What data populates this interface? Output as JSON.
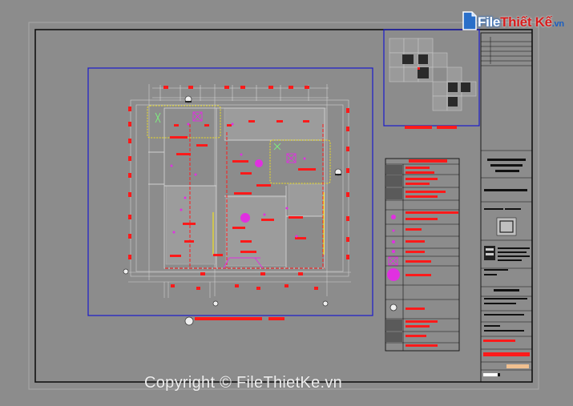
{
  "logo": {
    "brand_white": "File",
    "brand_red": "Thiết Kế",
    "domain": ".vn"
  },
  "watermark": "Copyright © FileThietKe.vn",
  "colors": {
    "background": "#8c8c8c",
    "frame": "#111111",
    "viewport_border": "#1a1acc",
    "annotation_red": "#ff1a1a",
    "fixture_magenta": "#e030e0",
    "highlight_yellow": "#f0e020",
    "wall": "#d8d8d8"
  },
  "icons": [
    "title-block-logo-icon",
    "legend-fixture-icon",
    "callout-marker-icon",
    "grid-bubble-icon",
    "key-plan-icon"
  ]
}
